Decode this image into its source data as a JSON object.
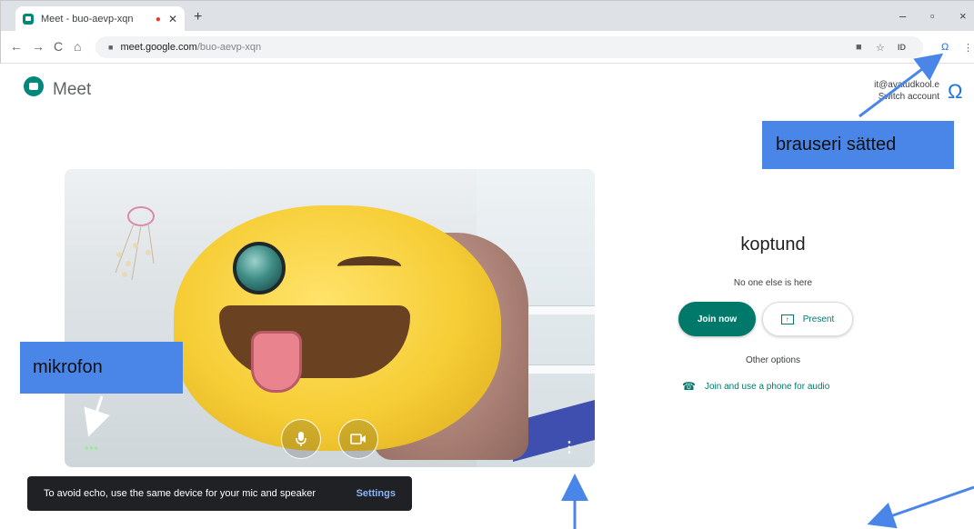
{
  "browser": {
    "tab_title": "Meet - buo-aevp-xqn",
    "tab_recording_icon": "recording-dot-icon",
    "new_tab": "+",
    "window_controls": {
      "minimize": "–",
      "restore": "▫",
      "close": "×"
    },
    "nav": {
      "back": "←",
      "forward": "→",
      "reload": "C",
      "home": "⌂"
    },
    "url_host": "meet.google.com",
    "url_path": "/buo-aevp-xqn",
    "toolbar_icons": [
      "camera-icon",
      "star-icon",
      "extension-icon",
      "profile-icon",
      "menu-icon"
    ]
  },
  "meet": {
    "brand": "Meet",
    "account_email": "it@avatudkool.e",
    "switch_account": "Switch account",
    "meeting_name": "koptund",
    "status": "No one else is here",
    "join_label": "Join now",
    "present_label": "Present",
    "other_options": "Other options",
    "phone_option": "Join and use a phone for audio",
    "video_dots": "•••",
    "more_options": "⋮"
  },
  "snackbar": {
    "message": "To avoid echo, use the same device for your mic and speaker",
    "action": "Settings"
  },
  "annotations": {
    "mic": "mikrofon",
    "browser_settings": "brauseri sätted",
    "color": "#4a86e8"
  },
  "colors": {
    "meet_teal": "#00796b",
    "annotation_blue": "#4a86e8",
    "snackbar_bg": "#202124"
  }
}
